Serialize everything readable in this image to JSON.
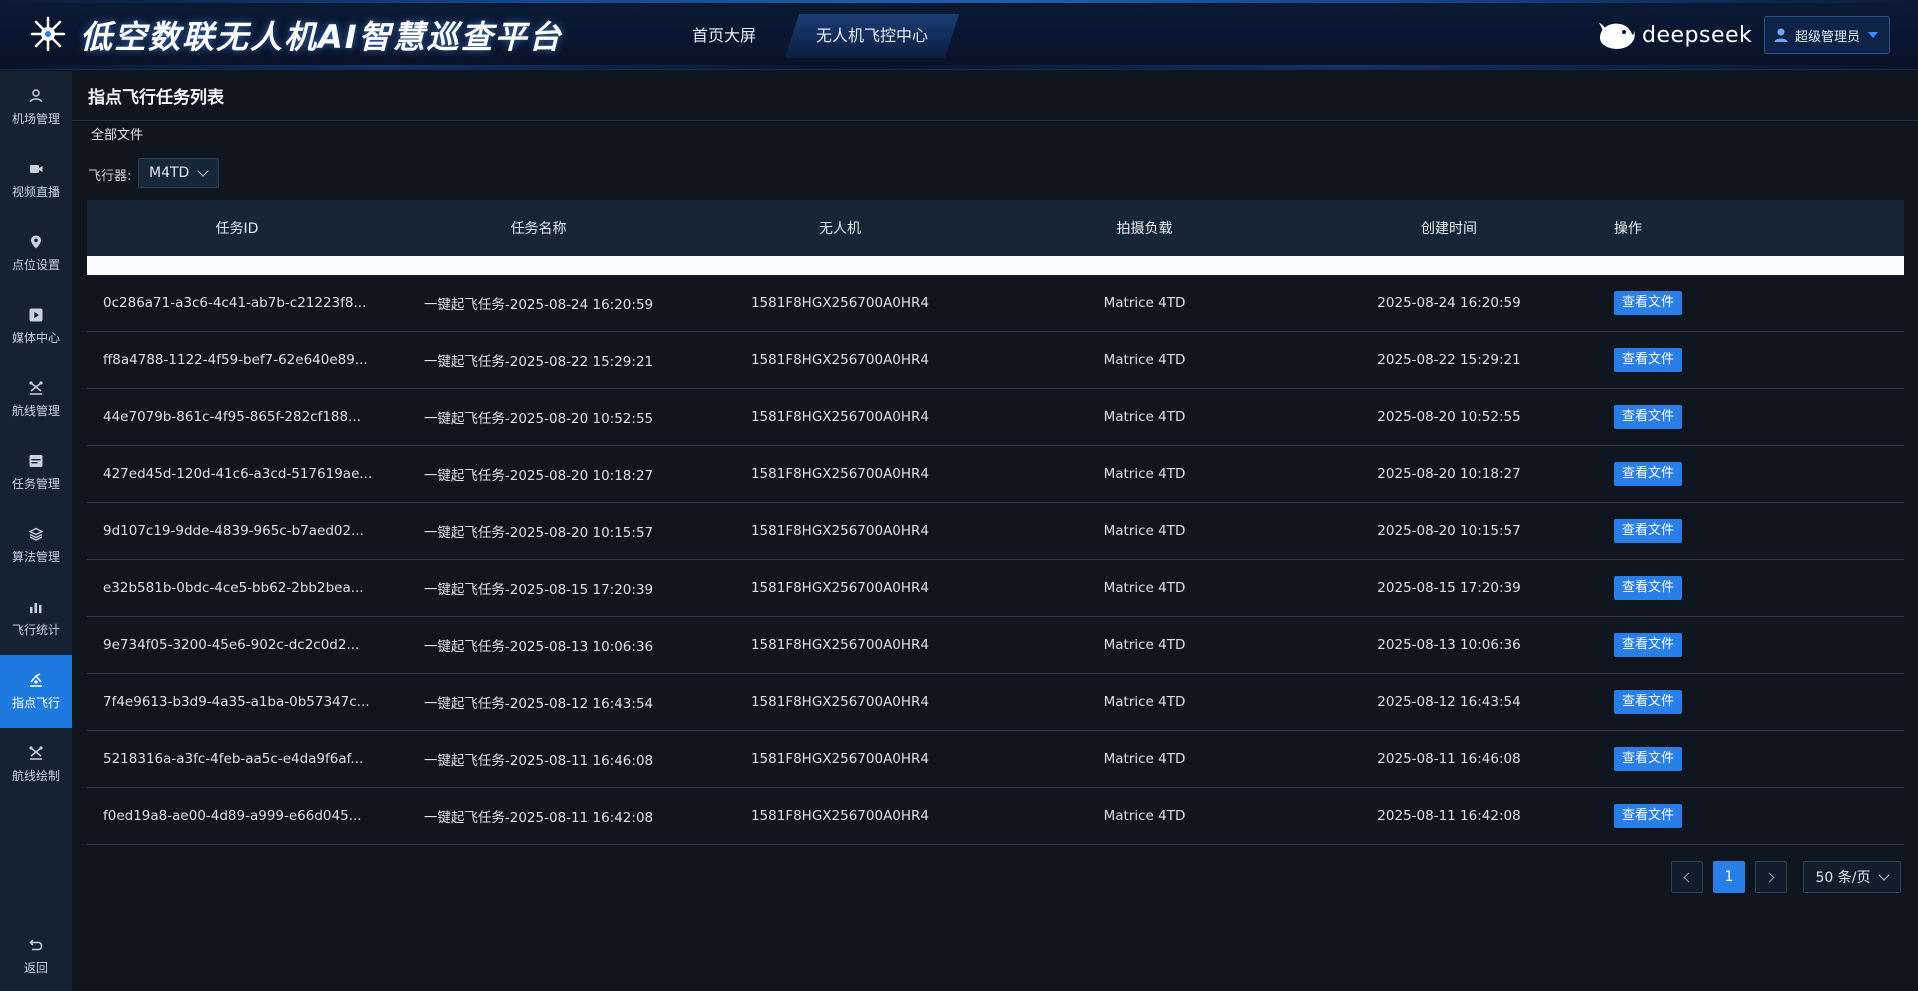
{
  "header": {
    "app_title": "低空数联无人机AI智慧巡查平台",
    "nav": [
      "首页大屏",
      "无人机飞控中心"
    ],
    "brand": "deepseek",
    "user": "超级管理员"
  },
  "sidebar": {
    "items": [
      {
        "label": "机场管理",
        "icon": "user-icon"
      },
      {
        "label": "视频直播",
        "icon": "video-camera-icon"
      },
      {
        "label": "点位设置",
        "icon": "map-pin-icon"
      },
      {
        "label": "媒体中心",
        "icon": "play-icon"
      },
      {
        "label": "航线管理",
        "icon": "drone-icon"
      },
      {
        "label": "任务管理",
        "icon": "task-icon"
      },
      {
        "label": "算法管理",
        "icon": "layers-icon"
      },
      {
        "label": "飞行统计",
        "icon": "bar-chart-icon"
      },
      {
        "label": "指点飞行",
        "icon": "pointer-flight-icon"
      },
      {
        "label": "航线绘制",
        "icon": "drone-icon"
      }
    ],
    "active_index": 8,
    "back_label": "返回"
  },
  "main": {
    "page_title": "指点飞行任务列表",
    "breadcrumb": "全部文件",
    "filter_label": "飞行器:",
    "filter_value": "M4TD",
    "accent_color": "#2a7ee8"
  },
  "table": {
    "headers": [
      "任务ID",
      "任务名称",
      "无人机",
      "拍摄负载",
      "创建时间",
      "操作"
    ],
    "action_label": "查看文件",
    "rows": [
      {
        "id": "0c286a71-a3c6-4c41-ab7b-c21223f8...",
        "name": "一键起飞任务-2025-08-24 16:20:59",
        "drone": "1581F8HGX256700A0HR4",
        "payload": "Matrice 4TD",
        "created": "2025-08-24 16:20:59"
      },
      {
        "id": "ff8a4788-1122-4f59-bef7-62e640e89...",
        "name": "一键起飞任务-2025-08-22 15:29:21",
        "drone": "1581F8HGX256700A0HR4",
        "payload": "Matrice 4TD",
        "created": "2025-08-22 15:29:21"
      },
      {
        "id": "44e7079b-861c-4f95-865f-282cf188...",
        "name": "一键起飞任务-2025-08-20 10:52:55",
        "drone": "1581F8HGX256700A0HR4",
        "payload": "Matrice 4TD",
        "created": "2025-08-20 10:52:55"
      },
      {
        "id": "427ed45d-120d-41c6-a3cd-517619ae...",
        "name": "一键起飞任务-2025-08-20 10:18:27",
        "drone": "1581F8HGX256700A0HR4",
        "payload": "Matrice 4TD",
        "created": "2025-08-20 10:18:27"
      },
      {
        "id": "9d107c19-9dde-4839-965c-b7aed02...",
        "name": "一键起飞任务-2025-08-20 10:15:57",
        "drone": "1581F8HGX256700A0HR4",
        "payload": "Matrice 4TD",
        "created": "2025-08-20 10:15:57"
      },
      {
        "id": "e32b581b-0bdc-4ce5-bb62-2bb2bea...",
        "name": "一键起飞任务-2025-08-15 17:20:39",
        "drone": "1581F8HGX256700A0HR4",
        "payload": "Matrice 4TD",
        "created": "2025-08-15 17:20:39"
      },
      {
        "id": "9e734f05-3200-45e6-902c-dc2c0d2...",
        "name": "一键起飞任务-2025-08-13 10:06:36",
        "drone": "1581F8HGX256700A0HR4",
        "payload": "Matrice 4TD",
        "created": "2025-08-13 10:06:36"
      },
      {
        "id": "7f4e9613-b3d9-4a35-a1ba-0b57347c...",
        "name": "一键起飞任务-2025-08-12 16:43:54",
        "drone": "1581F8HGX256700A0HR4",
        "payload": "Matrice 4TD",
        "created": "2025-08-12 16:43:54"
      },
      {
        "id": "5218316a-a3fc-4feb-aa5c-e4da9f6af...",
        "name": "一键起飞任务-2025-08-11 16:46:08",
        "drone": "1581F8HGX256700A0HR4",
        "payload": "Matrice 4TD",
        "created": "2025-08-11 16:46:08"
      },
      {
        "id": "f0ed19a8-ae00-4d89-a999-e66d045...",
        "name": "一键起飞任务-2025-08-11 16:42:08",
        "drone": "1581F8HGX256700A0HR4",
        "payload": "Matrice 4TD",
        "created": "2025-08-11 16:42:08"
      }
    ]
  },
  "pagination": {
    "current_page": "1",
    "page_size": "50 条/页"
  }
}
